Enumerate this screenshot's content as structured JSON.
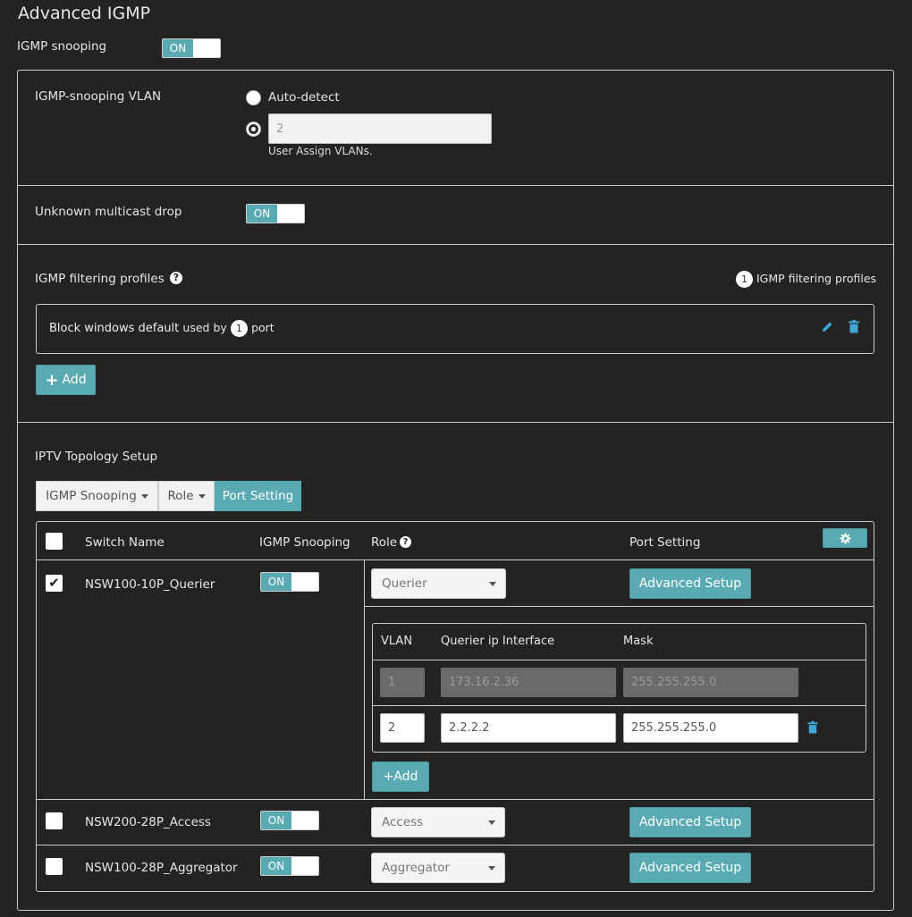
{
  "page": {
    "title": "Advanced IGMP"
  },
  "igmp_snooping": {
    "label": "IGMP snooping",
    "toggle": "ON"
  },
  "vlan": {
    "label": "IGMP-snooping VLAN",
    "auto_detect": "Auto-detect",
    "assign_value": "2",
    "assign_hint": "User Assign VLANs."
  },
  "unknown_multicast": {
    "label": "Unknown multicast drop",
    "toggle": "ON"
  },
  "filtering": {
    "label": "IGMP filtering profiles",
    "count": "1",
    "count_label": "IGMP filtering profiles",
    "profile_name": "Block windows default",
    "used_by": "used by",
    "port_count": "1",
    "port_label": "port",
    "add_label": "Add"
  },
  "iptv": {
    "label": "IPTV Topology Setup",
    "segments": [
      "IGMP Snooping",
      "Role",
      "Port Setting"
    ],
    "headers": {
      "switch_name": "Switch Name",
      "igmp_snooping": "IGMP Snooping",
      "role": "Role",
      "port_setting": "Port Setting"
    },
    "rows": [
      {
        "name": "NSW100-10P_Querier",
        "snooping": "ON",
        "role": "Querier",
        "checked": true,
        "action": "Advanced Setup"
      },
      {
        "name": "NSW200-28P_Access",
        "snooping": "ON",
        "role": "Access",
        "checked": false,
        "action": "Advanced Setup"
      },
      {
        "name": "NSW100-28P_Aggregator",
        "snooping": "ON",
        "role": "Aggregator",
        "checked": false,
        "action": "Advanced Setup"
      }
    ],
    "querier": {
      "headers": {
        "vlan": "VLAN",
        "interface": "Querier ip Interface",
        "mask": "Mask"
      },
      "entries": [
        {
          "vlan": "1",
          "ip": "173.16.2.36",
          "mask": "255.255.255.0"
        },
        {
          "vlan": "2",
          "ip": "2.2.2.2",
          "mask": "255.255.255.0"
        }
      ],
      "add_label": "+Add"
    }
  },
  "colors": {
    "accent": "#5aaab3",
    "background": "#232323",
    "icon_blue": "#3fa9d6"
  }
}
